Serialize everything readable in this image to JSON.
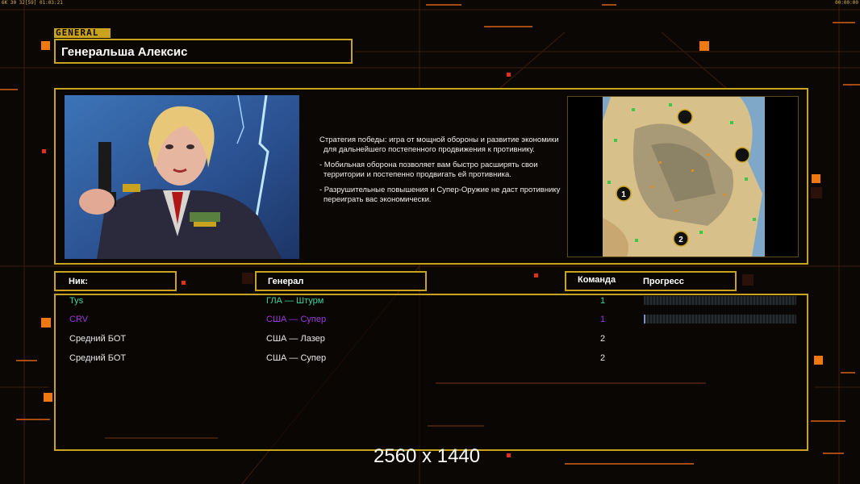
{
  "status_left": "6K 30 32[59] 01:03:21",
  "status_right": "00:00:00",
  "general_tag": "GENERAL",
  "general_name": "Генеральша Алексис",
  "description": [
    "Стратегия победы: игра от мощной обороны и развитие экономики для дальнейшего постепенного продвижения к противнику.",
    "- Мобильная оборона позволяет вам быстро расширять свои территории и постепенно продвигать ей противника.",
    "- Разрушительные повышения и Супер-Оружие не даст противнику переиграть вас экономически."
  ],
  "headers": {
    "nick": "Ник:",
    "general": "Генерал",
    "team": "Команда",
    "progress": "Прогресс"
  },
  "players": [
    {
      "nick": "Tys",
      "general": "ГЛА — Штурм",
      "team": "1",
      "color": "#3fd4a4",
      "progress": 0
    },
    {
      "nick": "CRV",
      "general": "США — Супер",
      "team": "1",
      "color": "#9a3ad8",
      "progress": 0.01
    },
    {
      "nick": "Средний БОТ",
      "general": "США — Лазер",
      "team": "2",
      "color": "#e8e8e8"
    },
    {
      "nick": "Средний БОТ",
      "general": "США — Супер",
      "team": "2",
      "color": "#e8e8e8"
    }
  ],
  "map_markers": [
    "1",
    "2"
  ],
  "resolution": "2560 x 1440",
  "accent_color": "#c9a21e"
}
